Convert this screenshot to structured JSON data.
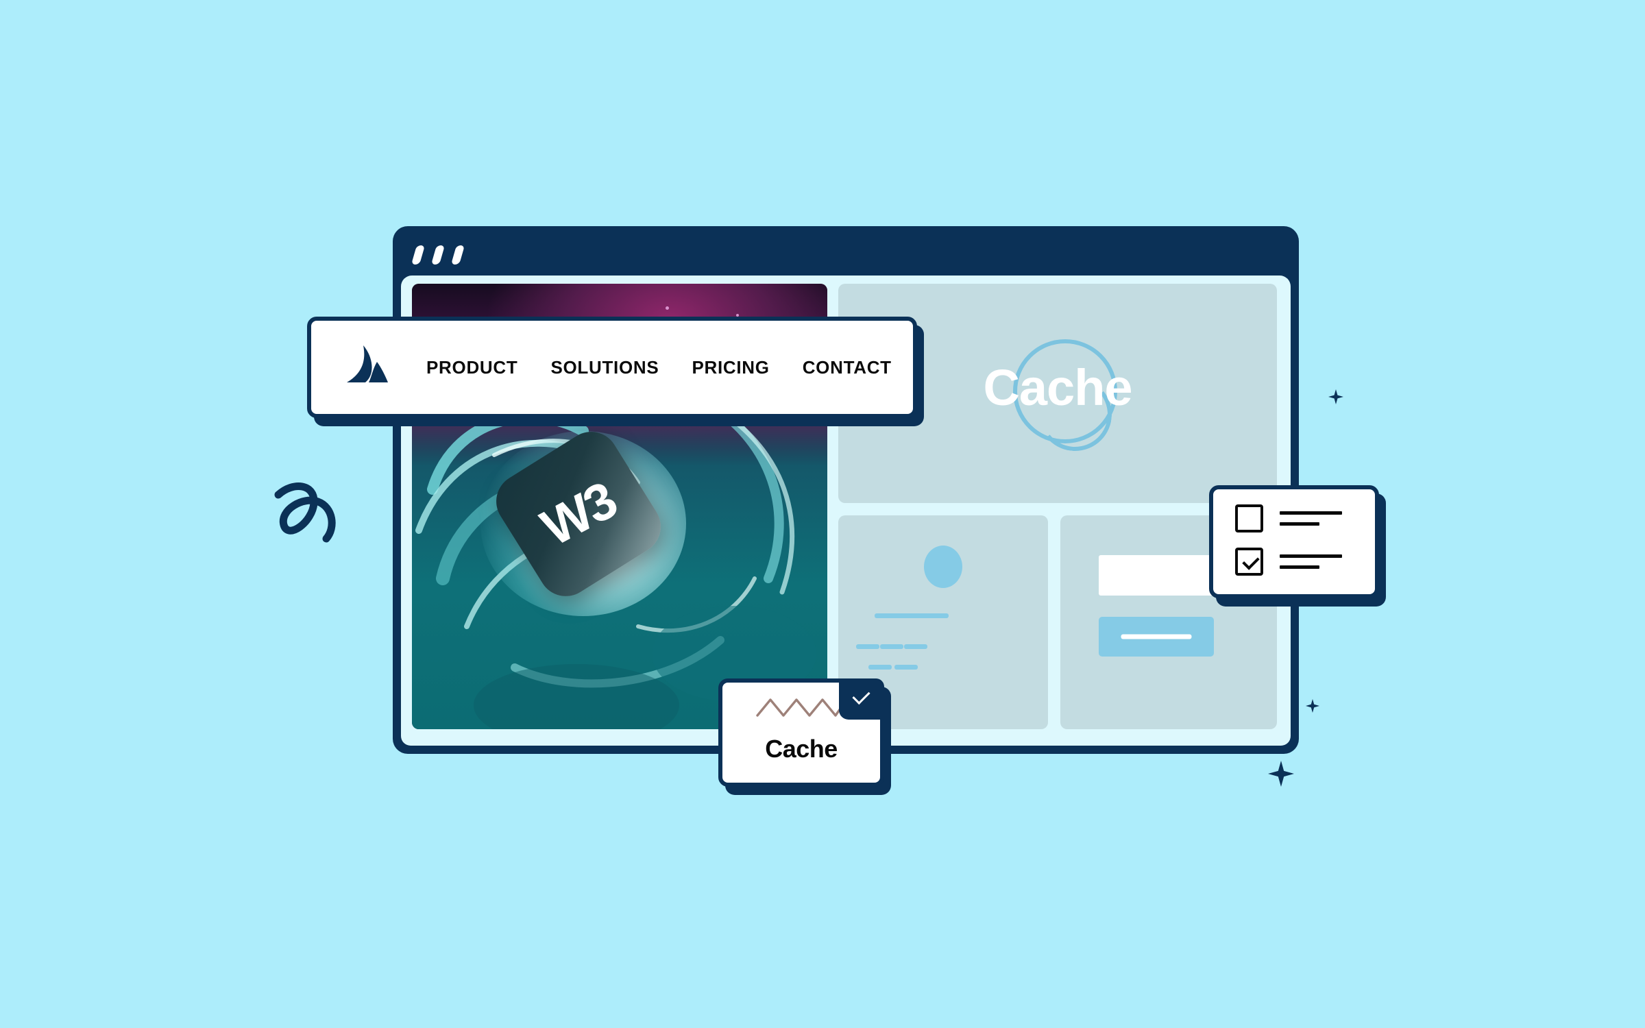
{
  "page": {
    "background_color": "#ADEDFB",
    "accent_navy": "#0B3157",
    "accent_blue": "#85CBE6"
  },
  "browser": {
    "titlebar": {
      "color": "#0B3157",
      "dots": [
        "window-dot-1",
        "window-dot-2",
        "window-dot-3"
      ]
    },
    "content_background": "#DDF8FD"
  },
  "hero": {
    "tile_label": "W3",
    "description": "abstract teal swirl artwork with purple starfield"
  },
  "navbar": {
    "logo_name": "atlassian-style-mountain-logo",
    "links": [
      {
        "label": "PRODUCT"
      },
      {
        "label": "SOLUTIONS"
      },
      {
        "label": "PRICING"
      },
      {
        "label": "CONTACT"
      }
    ]
  },
  "cache_panel": {
    "wordmark": "Cache",
    "wordmark_color": "#FFFFFF",
    "ring_color": "#7CC3DF",
    "panel_color": "#C3DCE1"
  },
  "profile_panel": {
    "avatar": "avatar-placeholder",
    "lines": 6
  },
  "form_panel": {
    "input_placeholder_block": "text-input-placeholder",
    "button_block": "submit-button-placeholder",
    "button_color": "#85CBE6"
  },
  "checklist_card": {
    "items": [
      {
        "checked": false,
        "line_primary": "checklist-line-long",
        "line_secondary": "checklist-line-short"
      },
      {
        "checked": true,
        "line_primary": "checklist-line-long",
        "line_secondary": "checklist-line-short"
      }
    ]
  },
  "cache_card": {
    "label": "Cache",
    "graphic": "zigzag-line",
    "graphic_color": "#9E8179",
    "badge": "check-badge",
    "badge_color": "#0B3157"
  },
  "decorations": {
    "squiggle": "squiggle-doodle",
    "sparkles": [
      "sparkle-small",
      "sparkle-small",
      "sparkle-large"
    ],
    "color": "#0B3157"
  }
}
